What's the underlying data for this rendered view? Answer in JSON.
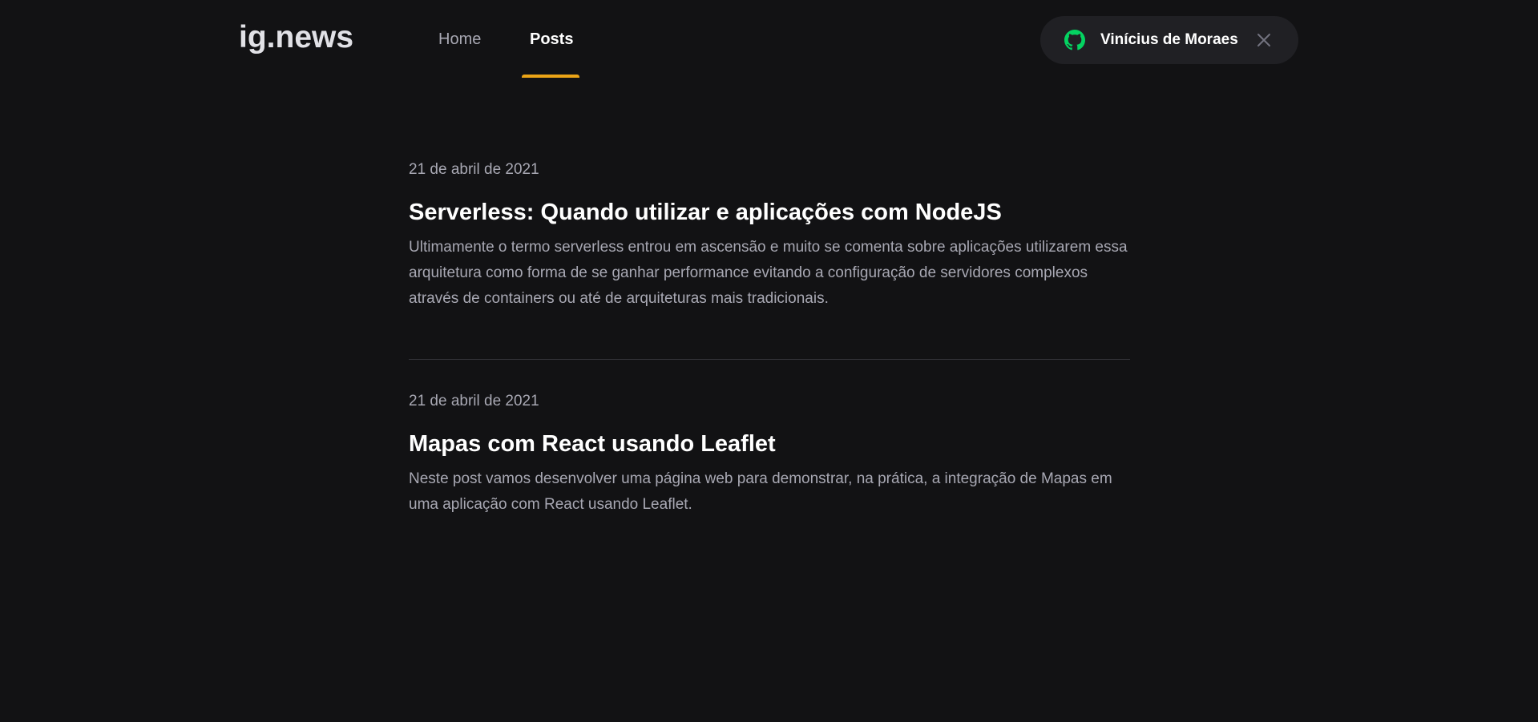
{
  "header": {
    "logo": "ig.news",
    "nav": {
      "home": "Home",
      "posts": "Posts"
    },
    "active_nav": "Posts",
    "accent_color": "#eba417",
    "user": {
      "name": "Vinícius de Moraes",
      "provider_icon": "github-icon",
      "provider_icon_color": "#04d361",
      "signout_icon": "close-icon"
    }
  },
  "posts": [
    {
      "date": "21 de abril de 2021",
      "title": "Serverless: Quando utilizar e aplicações com NodeJS",
      "excerpt": "Ultimamente o termo serverless entrou em ascensão e muito se comenta sobre aplicações utilizarem essa arquitetura como forma de se ganhar performance evitando a configuração de servidores complexos através de containers ou até de arquiteturas mais tradicionais."
    },
    {
      "date": "21 de abril de 2021",
      "title": "Mapas com React usando Leaflet",
      "excerpt": "Neste post vamos desenvolver uma página web para demonstrar, na prática, a integração de Mapas em uma aplicação com React usando Leaflet."
    }
  ]
}
